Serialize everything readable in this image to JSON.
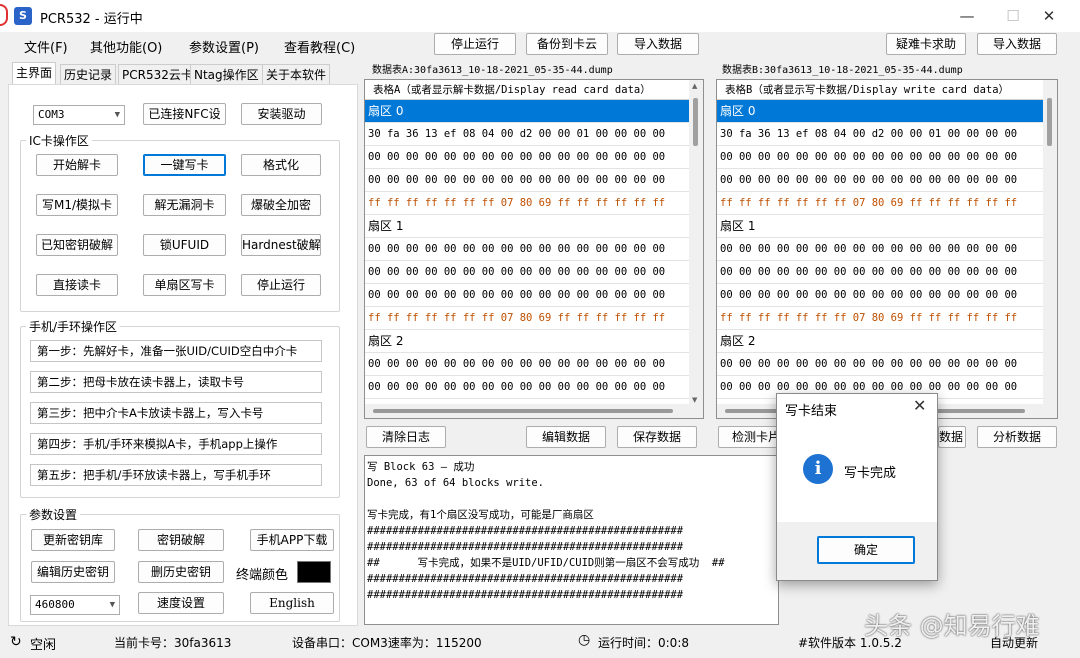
{
  "window": {
    "title": "PCR532 - 运行中",
    "icon_label": "S",
    "minimize": "—",
    "maximize": "☐",
    "close": "✕"
  },
  "menu": [
    "文件(F)",
    "其他功能(O)",
    "参数设置(P)",
    "查看教程(C)"
  ],
  "toolbar": {
    "stop": "停止运行",
    "backup": "备份到卡云",
    "import": "导入数据",
    "help": "疑难卡求助",
    "import2": "导入数据"
  },
  "tabs": [
    "主界面",
    "历史记录",
    "PCR532云卡",
    "Ntag操作区",
    "关于本软件"
  ],
  "left": {
    "port": "COM3",
    "nfc_connected": "已连接NFC设",
    "install_driver": "安装驱动",
    "ic_group": "IC卡操作区",
    "ic_buttons": [
      "开始解卡",
      "一键写卡",
      "格式化",
      "写M1/模拟卡",
      "解无漏洞卡",
      "爆破全加密",
      "已知密钥破解",
      "锁UFUID",
      "Hardnest破解",
      "直接读卡",
      "单扇区写卡",
      "停止运行"
    ],
    "phone_group": "手机/手环操作区",
    "steps": [
      "第一步：先解好卡，准备一张UID/CUID空白中介卡",
      "第二步：把母卡放在读卡器上，读取卡号",
      "第三步：把中介卡A卡放读卡器上，写入卡号",
      "第四步：手机/手环来模拟A卡，手机app上操作",
      "第五步：把手机/手环放读卡器上，写手机手环"
    ],
    "param_group": "参数设置",
    "params": [
      "更新密钥库",
      "密钥破解",
      "手机APP下载",
      "编辑历史密钥",
      "删历史密钥"
    ],
    "terminal_color": "终端颜色",
    "baud": "460800",
    "speed": "速度设置",
    "language": "English"
  },
  "tableA": {
    "label": "数据表A:30fa3613_10-18-2021_05-35-44.dump",
    "header": "表格A（或者显示解卡数据/Display read card data）"
  },
  "tableB": {
    "label": "数据表B:30fa3613_10-18-2021_05-35-44.dump",
    "header": "表格B（或者显示写卡数据/Display write card data）"
  },
  "rows": [
    {
      "t": "sector",
      "v": "扇区 0",
      "sel": true
    },
    {
      "t": "data",
      "v": "30 fa 36 13 ef 08 04 00 d2 00 00 01 00 00 00 00"
    },
    {
      "t": "data",
      "v": "00 00 00 00 00 00 00 00 00 00 00 00 00 00 00 00"
    },
    {
      "t": "data",
      "v": "00 00 00 00 00 00 00 00 00 00 00 00 00 00 00 00"
    },
    {
      "t": "trailer",
      "v": "ff ff ff ff ff ff ff 07 80 69 ff ff ff ff ff ff"
    },
    {
      "t": "sector",
      "v": "扇区 1"
    },
    {
      "t": "data",
      "v": "00 00 00 00 00 00 00 00 00 00 00 00 00 00 00 00"
    },
    {
      "t": "data",
      "v": "00 00 00 00 00 00 00 00 00 00 00 00 00 00 00 00"
    },
    {
      "t": "data",
      "v": "00 00 00 00 00 00 00 00 00 00 00 00 00 00 00 00"
    },
    {
      "t": "trailer",
      "v": "ff ff ff ff ff ff ff 07 80 69 ff ff ff ff ff ff"
    },
    {
      "t": "sector",
      "v": "扇区 2"
    },
    {
      "t": "data",
      "v": "00 00 00 00 00 00 00 00 00 00 00 00 00 00 00 00"
    },
    {
      "t": "data",
      "v": "00 00 00 00 00 00 00 00 00 00 00 00 00 00 00 00"
    }
  ],
  "actions": {
    "clear_log": "清除日志",
    "edit": "编辑数据",
    "save": "保存数据",
    "detect": "检测卡片",
    "data": "数据",
    "analyze": "分析数据"
  },
  "log": "写 Block 63 — 成功\nDone, 63 of 64 blocks write.\n\n写卡完成，有1个扇区没写成功，可能是厂商扇区\n##################################################\n##################################################\n##      写卡完成，如果不是UID/UFID/CUID则第一扇区不会写成功  ##\n##################################################\n##################################################",
  "dialog": {
    "title": "写卡结束",
    "message": "写卡完成",
    "ok": "确定",
    "icon": "i"
  },
  "status": {
    "idle": "空闲",
    "card": "当前卡号：30fa3613",
    "port": "设备串口：COM3速率为：115200",
    "runtime": "运行时间：0:0:8",
    "version": "#软件版本 1.0.5.2",
    "update": "自动更新"
  },
  "watermark": "头条 @知易行难"
}
